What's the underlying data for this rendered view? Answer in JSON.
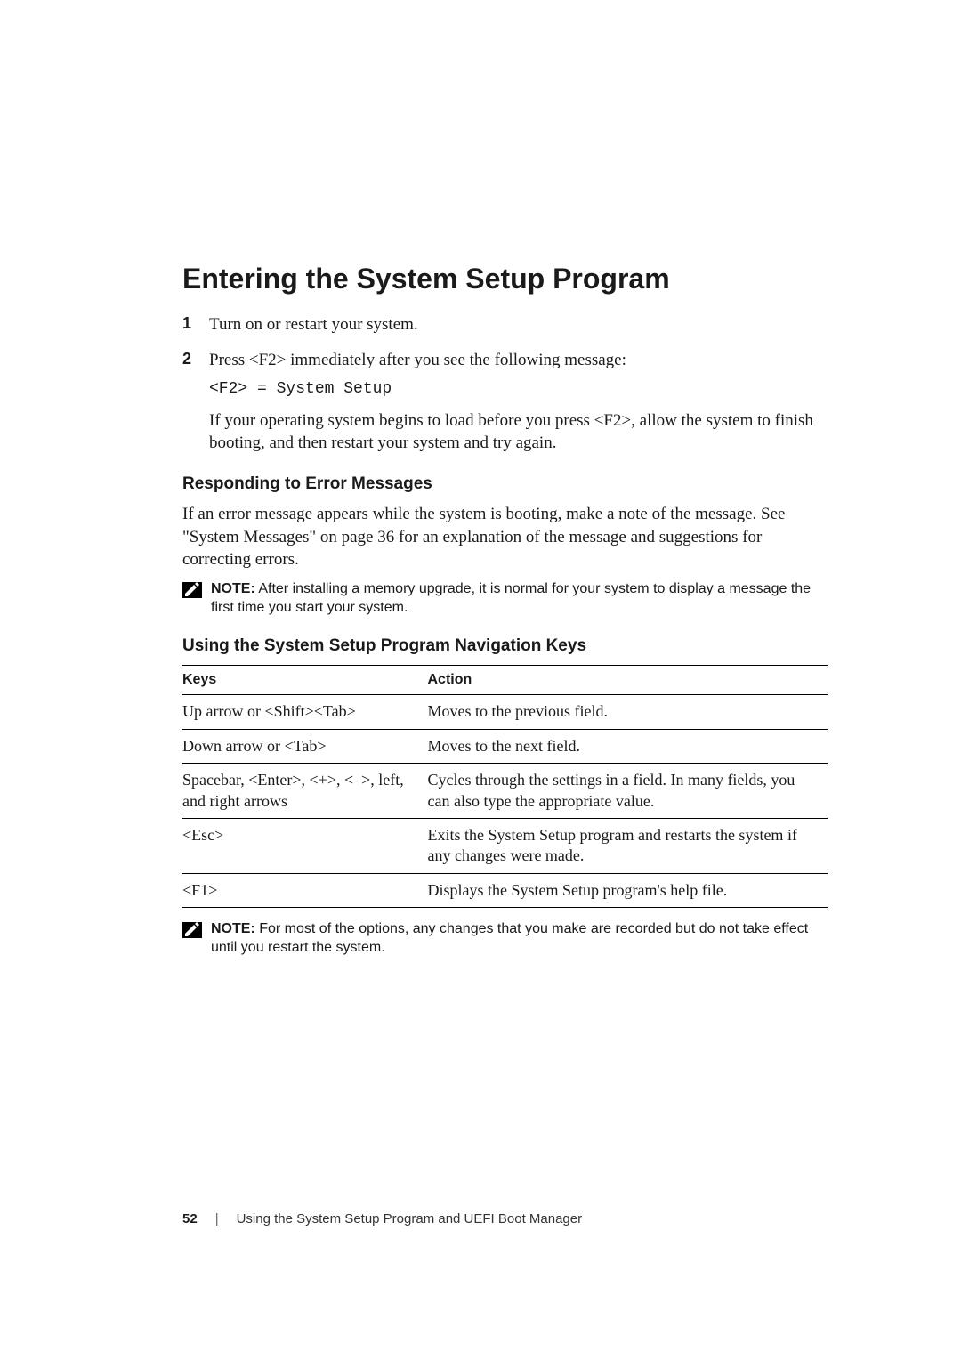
{
  "title": "Entering the System Setup Program",
  "steps": [
    {
      "num": "1",
      "text": "Turn on or restart your system."
    },
    {
      "num": "2",
      "text": "Press <F2> immediately after you see the following message:",
      "code": "<F2> = System Setup",
      "after": "If your operating system begins to load before you press <F2>, allow the system to finish booting, and then restart your system and try again."
    }
  ],
  "section1": {
    "heading": "Responding to Error Messages",
    "para": "If an error message appears while the system is booting, make a note of the message. See \"System Messages\" on page 36 for an explanation of the message and suggestions for correcting errors."
  },
  "note1": {
    "label": "NOTE:",
    "text": " After installing a memory upgrade, it is normal for your system to display a message the first time you start your system."
  },
  "section2": {
    "heading": "Using the System Setup Program Navigation Keys"
  },
  "table": {
    "headers": [
      "Keys",
      "Action"
    ],
    "rows": [
      [
        "Up arrow or <Shift><Tab>",
        "Moves to the previous field."
      ],
      [
        "Down arrow or <Tab>",
        "Moves to the next field."
      ],
      [
        "Spacebar, <Enter>, <+>, <–>, left, and right arrows",
        "Cycles through the settings in a field. In many fields, you can also type the appropriate value."
      ],
      [
        "<Esc>",
        "Exits the System Setup program and restarts the system if any changes were made."
      ],
      [
        "<F1>",
        "Displays the System Setup program's help file."
      ]
    ]
  },
  "note2": {
    "label": "NOTE:",
    "text": " For most of the options, any changes that you make are recorded but do not take effect until you restart the system."
  },
  "footer": {
    "page": "52",
    "sep": "|",
    "title": "Using the System Setup Program and UEFI Boot Manager"
  }
}
